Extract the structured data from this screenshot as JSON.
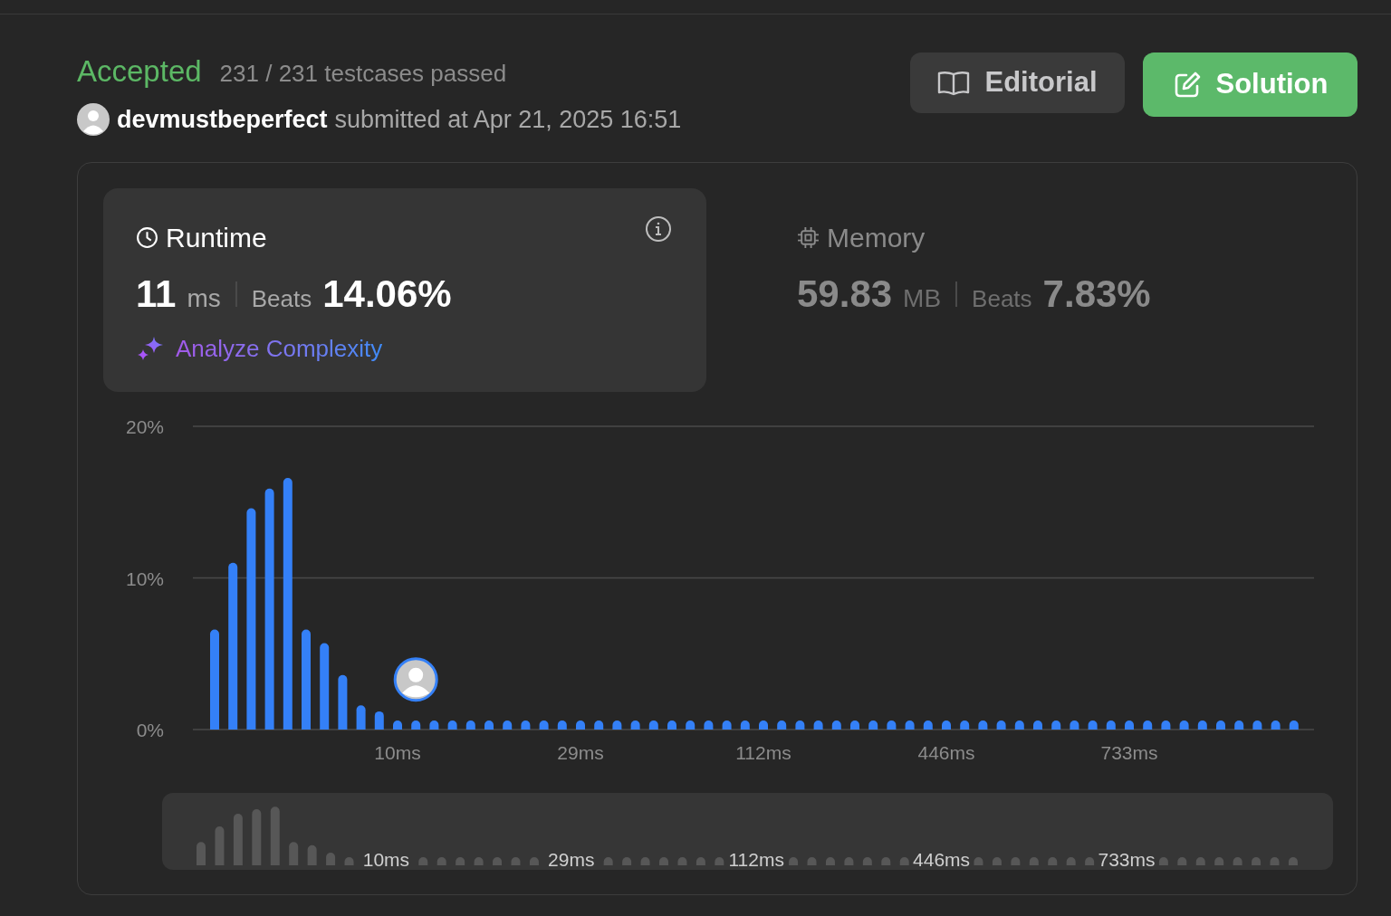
{
  "status": {
    "verdict": "Accepted",
    "testcases": "231 / 231 testcases passed"
  },
  "submission": {
    "user": "devmustbeperfect",
    "submitted": "submitted at Apr 21, 2025 16:51"
  },
  "buttons": [
    {
      "label": "Editorial",
      "kind": "secondary"
    },
    {
      "label": "Solution",
      "kind": "primary"
    }
  ],
  "metrics": [
    {
      "kind": "runtime",
      "title": "Runtime",
      "value": "11",
      "unit": "ms",
      "beats_label": "Beats",
      "beats": "14.06%",
      "selected": true,
      "link": "Analyze Complexity"
    },
    {
      "kind": "memory",
      "title": "Memory",
      "value": "59.83",
      "unit": "MB",
      "beats_label": "Beats",
      "beats": "7.83%",
      "selected": false
    }
  ],
  "chart_data": {
    "type": "bar",
    "ylim": [
      0,
      20
    ],
    "categories": [
      null,
      null,
      null,
      null,
      null,
      null,
      null,
      null,
      null,
      null,
      "10ms",
      null,
      null,
      null,
      null,
      null,
      null,
      null,
      null,
      null,
      "29ms",
      null,
      null,
      null,
      null,
      null,
      null,
      null,
      null,
      null,
      "112ms",
      null,
      null,
      null,
      null,
      null,
      null,
      null,
      null,
      null,
      "446ms",
      null,
      null,
      null,
      null,
      null,
      null,
      null,
      null,
      null,
      "733ms",
      null,
      null,
      null,
      null,
      null,
      null,
      null,
      null,
      null
    ],
    "yticks": [
      {
        "value": 0,
        "label": "0%"
      },
      {
        "value": 10,
        "label": "10%"
      },
      {
        "value": 20,
        "label": "20%"
      }
    ],
    "series": [
      {
        "color": "#3480f7",
        "values": [
          6.6,
          11.0,
          14.6,
          15.9,
          16.6,
          6.6,
          5.7,
          3.6,
          1.6,
          1.2,
          0.6,
          0.6,
          0.6,
          0.6,
          0.6,
          0.6,
          0.6,
          0.6,
          0.6,
          0.6,
          0.6,
          0.6,
          0.6,
          0.6,
          0.6,
          0.6,
          0.6,
          0.6,
          0.6,
          0.6,
          0.6,
          0.6,
          0.6,
          0.6,
          0.6,
          0.6,
          0.6,
          0.6,
          0.6,
          0.6,
          0.6,
          0.6,
          0.6,
          0.6,
          0.6,
          0.6,
          0.6,
          0.6,
          0.6,
          0.6,
          0.6,
          0.6,
          0.6,
          0.6,
          0.6,
          0.6,
          0.6,
          0.6,
          0.6,
          0.6
        ]
      }
    ]
  },
  "overview": {
    "labels": [
      "10ms",
      "29ms",
      "112ms",
      "446ms",
      "733ms"
    ]
  }
}
